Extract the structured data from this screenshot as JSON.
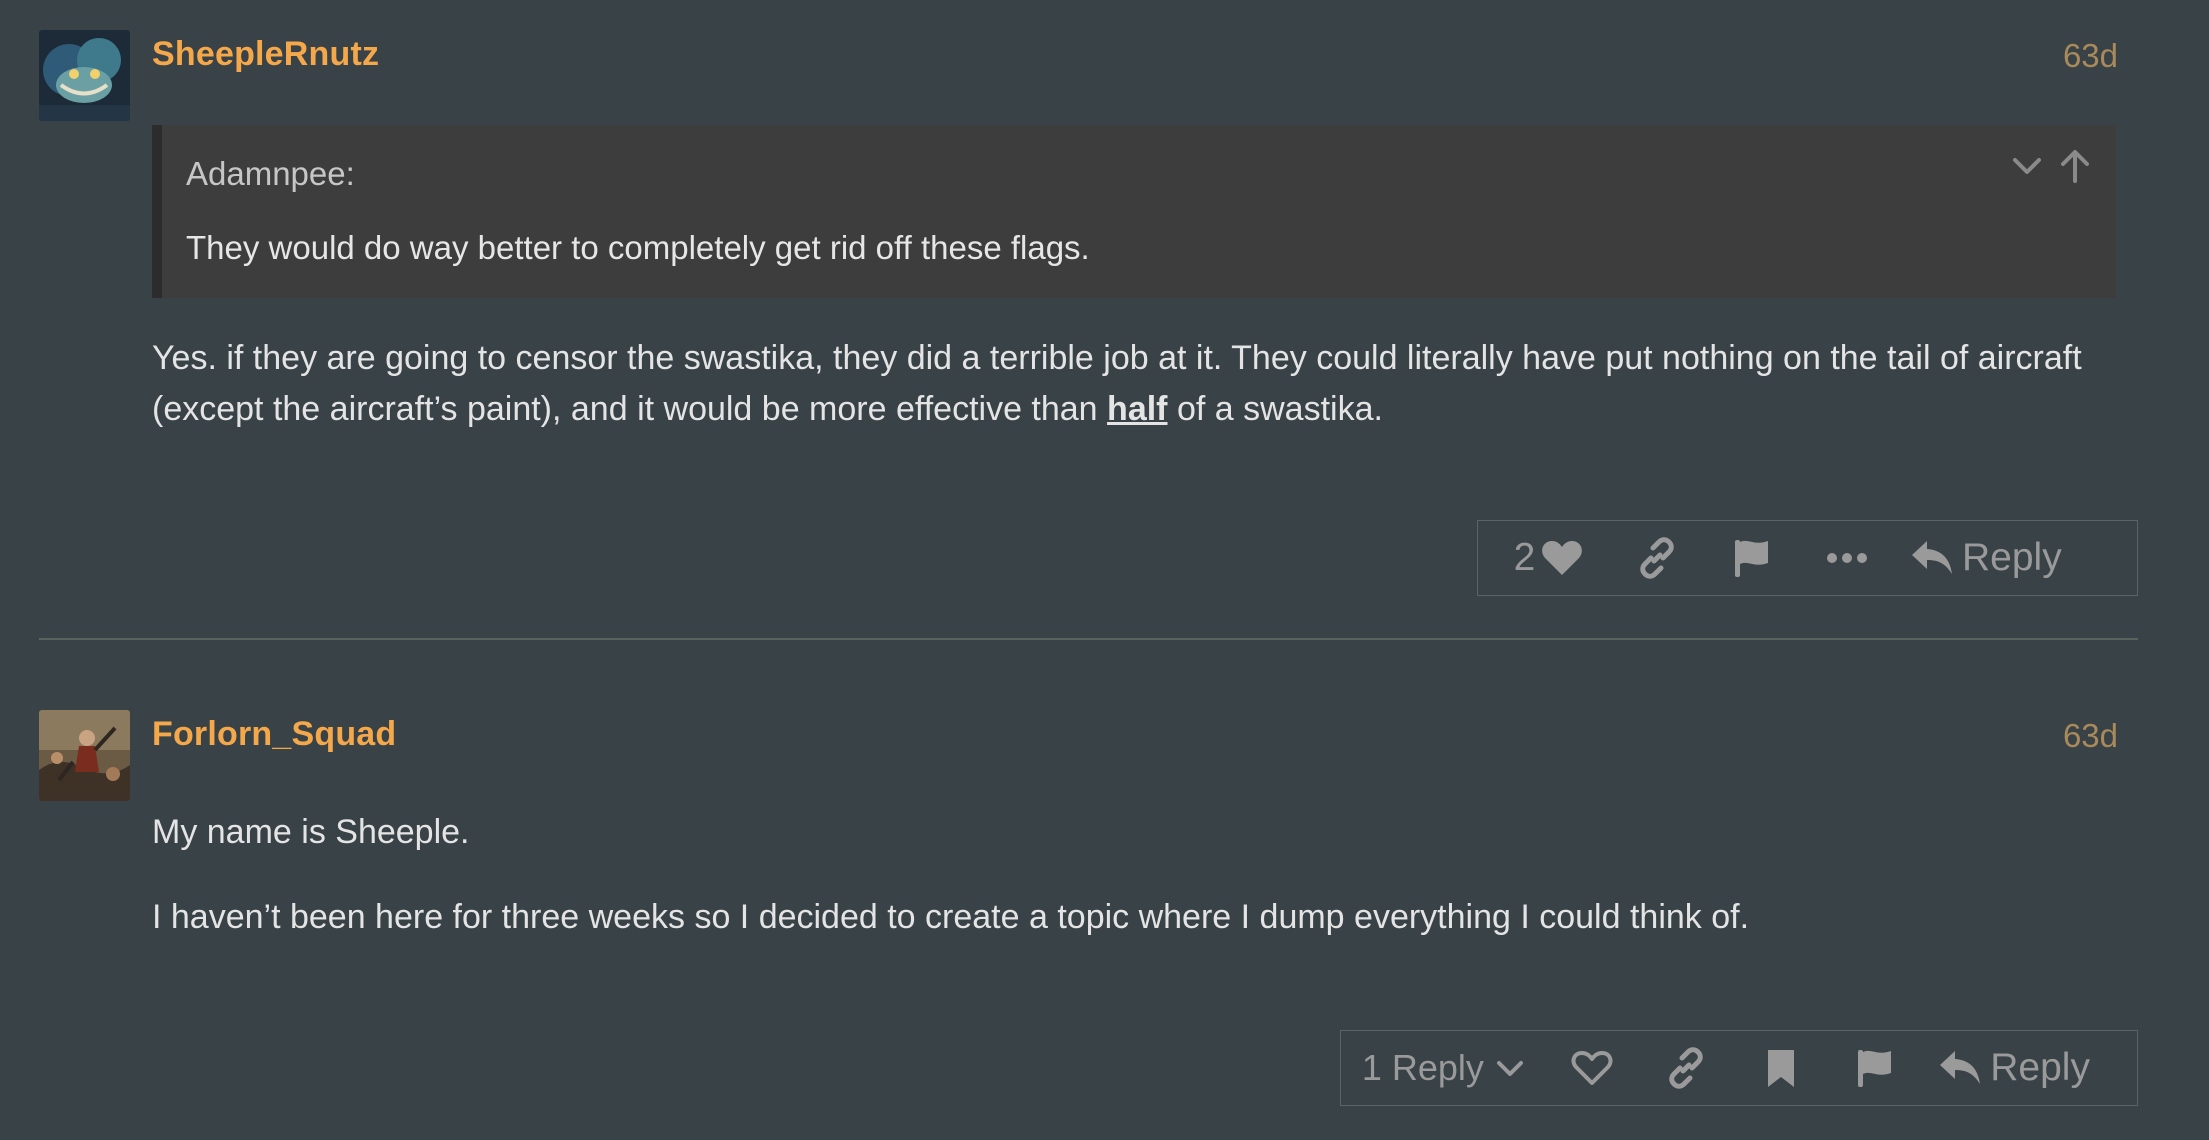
{
  "posts": [
    {
      "username": "SheepleRnutz",
      "timestamp": "63d",
      "quote": {
        "author": "Adamnpee:",
        "text": "They would do way better to completely get rid off these flags."
      },
      "body_before": "Yes. if they are going to censor the swastika, they did a terrible job at it. They could literally have put nothing on the tail of aircraft (except the aircraft’s paint), and it would be more effective than ",
      "body_emphasis": "half",
      "body_after": " of a swastika.",
      "actions": {
        "like_count": "2",
        "reply_label": "Reply"
      }
    },
    {
      "username": "Forlorn_Squad",
      "timestamp": "63d",
      "paragraphs": [
        "My name is Sheeple.",
        "I haven’t been here for three weeks so I decided to create a topic where I dump everything I could think of."
      ],
      "actions": {
        "replies_label": "1 Reply",
        "reply_label": "Reply"
      }
    }
  ],
  "icons": {
    "heart": "heart-icon",
    "link": "link-icon",
    "flag": "flag-icon",
    "more": "ellipsis-icon",
    "reply": "reply-arrow-icon",
    "bookmark": "bookmark-icon",
    "chevron": "chevron-down-icon",
    "arrow_up": "arrow-up-icon"
  },
  "colors": {
    "background": "#384247",
    "username": "#f5a84a",
    "timestamp": "#a98a5b",
    "quote_bg": "#3d3d3d"
  }
}
